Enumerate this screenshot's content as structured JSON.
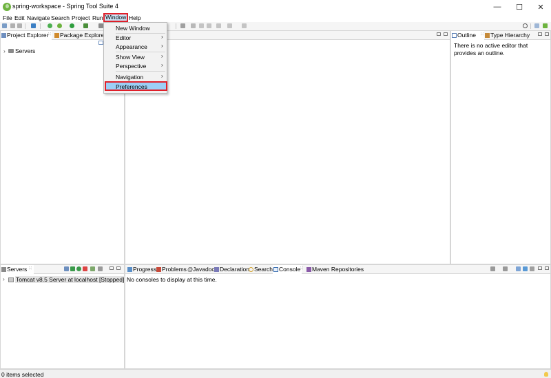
{
  "window": {
    "title": "spring-workspace - Spring Tool Suite 4",
    "controls": {
      "minimize": "—",
      "maximize": "☐",
      "close": "✕"
    }
  },
  "menubar": {
    "items": [
      "File",
      "Edit",
      "Navigate",
      "Search",
      "Project",
      "Run",
      "Window",
      "Help"
    ]
  },
  "window_menu": {
    "new_window": "New Window",
    "editor": "Editor",
    "appearance": "Appearance",
    "show_view": "Show View",
    "perspective": "Perspective",
    "navigation": "Navigation",
    "preferences": "Preferences",
    "submenu_arrow": "›"
  },
  "left_panel": {
    "tabs": [
      "Project Explorer",
      "Package Explorer"
    ],
    "tree_items": [
      "Servers"
    ],
    "expand_glyph": "›"
  },
  "outline_panel": {
    "tabs": [
      "Outline",
      "Type Hierarchy"
    ],
    "message": "There is no active editor that provides an outline."
  },
  "servers_panel": {
    "tab": "Servers",
    "items": [
      "Tomcat v8.5 Server at localhost  [Stopped]"
    ]
  },
  "bottom_panel": {
    "tabs": [
      "Progress",
      "Problems",
      "Javadoc",
      "Declaration",
      "Search",
      "Console",
      "Maven Repositories"
    ],
    "message": "No consoles to display at this time."
  },
  "status": {
    "text": "0 items selected"
  },
  "colors": {
    "accent_highlight": "#e0202a",
    "menu_selection": "#9ccff6",
    "spring_green": "#6db33f"
  }
}
